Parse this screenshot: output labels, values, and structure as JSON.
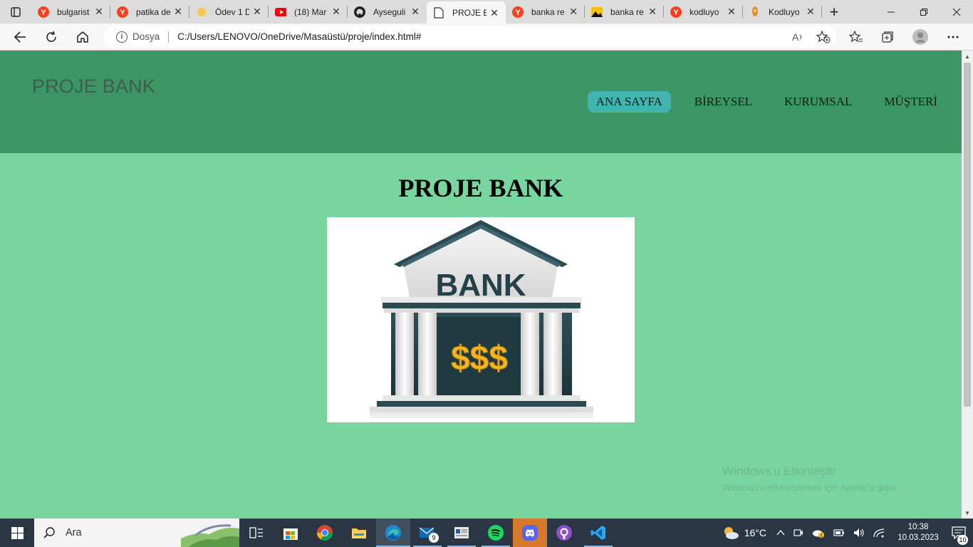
{
  "browser": {
    "tabs": [
      {
        "title": "bulgarist",
        "icon": "yandex-icon"
      },
      {
        "title": "patika de",
        "icon": "yandex-icon"
      },
      {
        "title": "Ödev 1 D",
        "icon": "sun-icon"
      },
      {
        "title": "(18) Mar",
        "icon": "youtube-icon"
      },
      {
        "title": "Ayseguli",
        "icon": "github-icon"
      },
      {
        "title": "PROJE B",
        "icon": "document-icon",
        "active": true
      },
      {
        "title": "banka re",
        "icon": "yandex-icon"
      },
      {
        "title": "banka re",
        "icon": "image-icon"
      },
      {
        "title": "kodluyo",
        "icon": "yandex-icon"
      },
      {
        "title": "Kodluyo",
        "icon": "rocket-icon"
      }
    ],
    "address": {
      "scheme_label": "Dosya",
      "url": "C:/Users/LENOVO/OneDrive/Masaüstü/proje/index.html#"
    }
  },
  "site": {
    "logo": "PROJE BANK",
    "nav": [
      {
        "label": "ANA SAYFA",
        "active": true
      },
      {
        "label": "BİREYSEL"
      },
      {
        "label": "KURUMSAL"
      },
      {
        "label": "MÜŞTERİ"
      }
    ],
    "hero_title": "PROJE BANK",
    "image": {
      "sign_text": "BANK",
      "symbols": "$$$"
    }
  },
  "watermark": {
    "line1": "Windows'u Etkinleştir",
    "line2": "Windows'u etkinleştirmek için Ayarlar'a gidin."
  },
  "taskbar": {
    "search_placeholder": "Ara",
    "weather": "16°C",
    "time": "10:38",
    "date": "10.03.2023",
    "mail_badge": "9",
    "notification_badge": "10"
  },
  "colors": {
    "header": "#3b9664",
    "body": "#77d59d",
    "active_nav": "#43b3b0"
  }
}
